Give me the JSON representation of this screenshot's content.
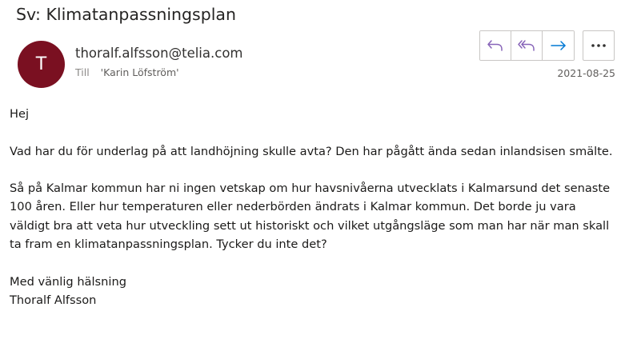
{
  "email": {
    "subject": "Sv: Klimatanpassningsplan",
    "avatar_initial": "T",
    "sender": "thoralf.alfsson@telia.com",
    "to_label": "Till",
    "recipient": "'Karin Löfström'",
    "date": "2021-08-25"
  },
  "actions": {
    "reply_icon": "reply-icon",
    "reply_all_icon": "reply-all-icon",
    "forward_icon": "forward-icon",
    "more_icon": "more-icon",
    "accent_color": "#8764b8",
    "forward_color": "#0078d4"
  },
  "body": {
    "greeting": "Hej",
    "paragraph1": "Vad har du för underlag på att landhöjning skulle avta? Den har pågått ända sedan inlandsisen smälte.",
    "paragraph2": "Så på Kalmar kommun har ni ingen vetskap om hur havsnivåerna utvecklats i Kalmarsund det senaste 100 åren. Eller hur temperaturen eller nederbörden ändrats i Kalmar kommun. Det borde ju vara väldigt bra att veta hur utveckling sett ut historiskt och vilket utgångsläge som man har när man skall ta fram en klimatanpassningsplan. Tycker du inte det?",
    "closing": "Med vänlig hälsning",
    "signature": "Thoralf Alfsson"
  }
}
